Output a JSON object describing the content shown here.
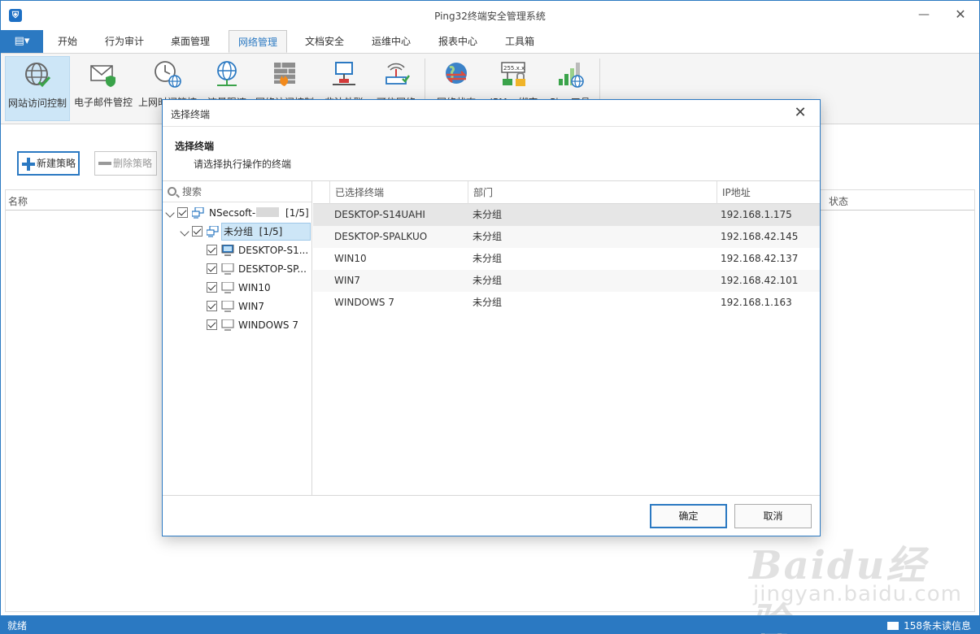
{
  "app": {
    "title": "Ping32终端安全管理系统"
  },
  "menu": {
    "tabs": [
      "开始",
      "行为审计",
      "桌面管理",
      "网络管理",
      "文档安全",
      "运维中心",
      "报表中心",
      "工具箱"
    ],
    "active_tab": "网络管理"
  },
  "ribbon": {
    "items": [
      "网站访问控制",
      "电子邮件管控",
      "上网时间管控",
      "流量限速",
      "网络访问控制",
      "非法外联",
      "可信网络",
      "网络状态",
      "IPMac绑定",
      "Ping工具"
    ],
    "active_item": "网站访问控制"
  },
  "toolbar": {
    "new_label": "新建策略",
    "delete_label": "删除策略"
  },
  "list": {
    "col_name": "名称",
    "col_status": "状态"
  },
  "statusbar": {
    "left": "就绪",
    "right": "158条未读信息"
  },
  "dialog": {
    "title": "选择终端",
    "header_title": "选择终端",
    "header_desc": "请选择执行操作的终端",
    "search_placeholder": "搜索",
    "tree": {
      "root_label": "NSecsoft-",
      "root_count": "[1/5]",
      "group_label": "未分组",
      "group_count": "[1/5]",
      "items": [
        "DESKTOP-S1...",
        "DESKTOP-SP...",
        "WIN10",
        "WIN7",
        "WINDOWS 7"
      ]
    },
    "table": {
      "headers": [
        "已选择终端",
        "部门",
        "IP地址"
      ],
      "rows": [
        {
          "name": "DESKTOP-S14UAHI",
          "dept": "未分组",
          "ip": "192.168.1.175"
        },
        {
          "name": "DESKTOP-SPALKUO",
          "dept": "未分组",
          "ip": "192.168.42.145"
        },
        {
          "name": "WIN10",
          "dept": "未分组",
          "ip": "192.168.42.137"
        },
        {
          "name": "WIN7",
          "dept": "未分组",
          "ip": "192.168.42.101"
        },
        {
          "name": "WINDOWS 7",
          "dept": "未分组",
          "ip": "192.168.1.163"
        }
      ]
    },
    "ok_label": "确定",
    "cancel_label": "取消"
  },
  "watermark": {
    "line1": "Baidu经验",
    "line2": "jingyan.baidu.com"
  },
  "colors": {
    "accent": "#2b79c2",
    "ribbon_bg": "#f5f5f5",
    "selection": "#cde6f7"
  }
}
